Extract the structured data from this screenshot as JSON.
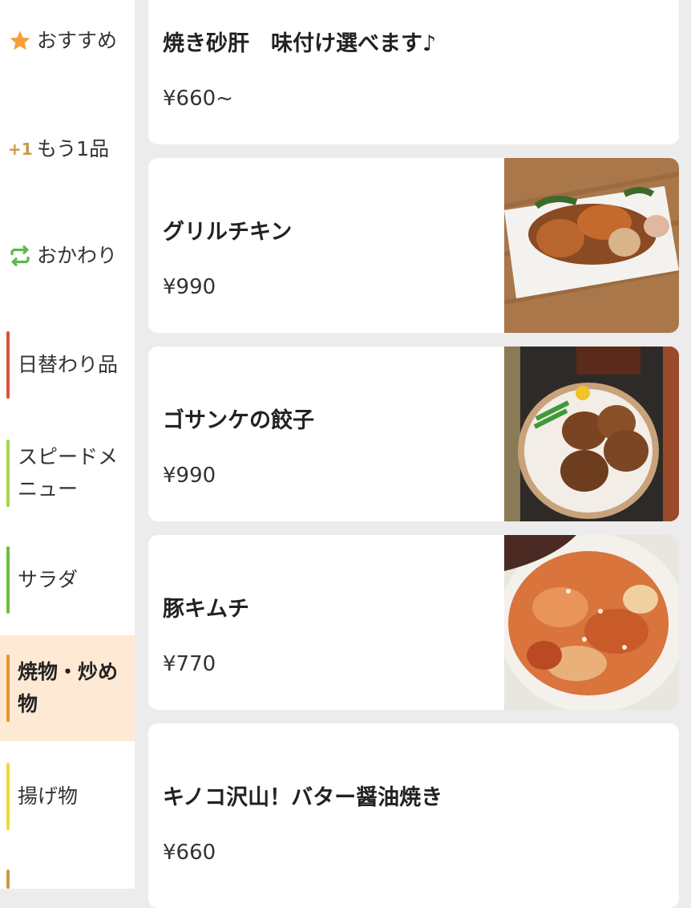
{
  "sidebar": {
    "items": [
      {
        "label": "おすすめ",
        "icon": "star-icon"
      },
      {
        "label": "もう1品",
        "icon": "plus-one-icon"
      },
      {
        "label": "おかわり",
        "icon": "refresh-icon"
      },
      {
        "label": "日替わり品",
        "color": "#d9533a"
      },
      {
        "label": "スピードメニュー",
        "color": "#a7d54a"
      },
      {
        "label": "サラダ",
        "color": "#6cbf3a"
      },
      {
        "label": "焼物・炒め物",
        "color": "#e6962f",
        "active": true
      },
      {
        "label": "揚げ物",
        "color": "#f0d83a"
      }
    ],
    "plus_one_text": "+1"
  },
  "menu": {
    "items": [
      {
        "name": "焼き砂肝　味付け選べます♪",
        "price": "¥660~",
        "has_photo": false
      },
      {
        "name": "グリルチキン",
        "price": "¥990",
        "has_photo": true,
        "photo": "grilled-chicken-photo"
      },
      {
        "name": "ゴサンケの餃子",
        "price": "¥990",
        "has_photo": true,
        "photo": "gyoza-photo"
      },
      {
        "name": "豚キムチ",
        "price": "¥770",
        "has_photo": true,
        "photo": "pork-kimchi-photo"
      },
      {
        "name": "キノコ沢山！バター醤油焼き",
        "price": "¥660",
        "has_photo": false
      }
    ]
  },
  "colors": {
    "accent": "#f5a03a",
    "active_bg": "#fde9d4",
    "background": "#ececec"
  }
}
